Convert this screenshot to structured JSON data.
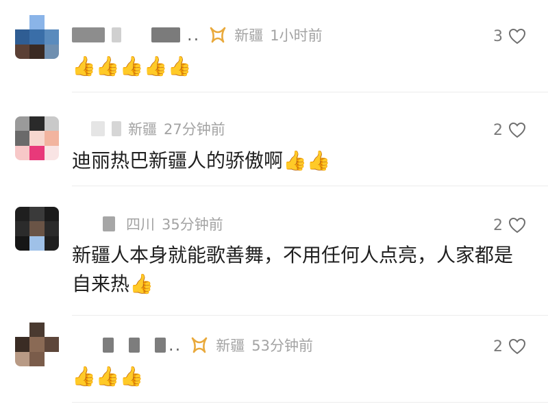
{
  "colors": {
    "meta_gray": "#a3a3a3",
    "badge_gold": "#e9a93b",
    "divider": "#ececec"
  },
  "comments": [
    {
      "location": "新疆",
      "time": "1小时前",
      "likes": "3",
      "text": "👍👍👍👍👍",
      "has_badge": true
    },
    {
      "location": "新疆",
      "time": "27分钟前",
      "likes": "2",
      "text": "迪丽热巴新疆人的骄傲啊👍👍",
      "has_badge": false
    },
    {
      "location": "四川",
      "time": "35分钟前",
      "likes": "2",
      "text": "新疆人本身就能歌善舞，不用任何人点亮，人家都是自来热👍",
      "has_badge": false
    },
    {
      "location": "新疆",
      "time": "53分钟前",
      "likes": "2",
      "text": "👍👍👍",
      "has_badge": true
    }
  ],
  "icons": {
    "badge": "vip-badge-icon",
    "like": "heart-outline-icon"
  }
}
